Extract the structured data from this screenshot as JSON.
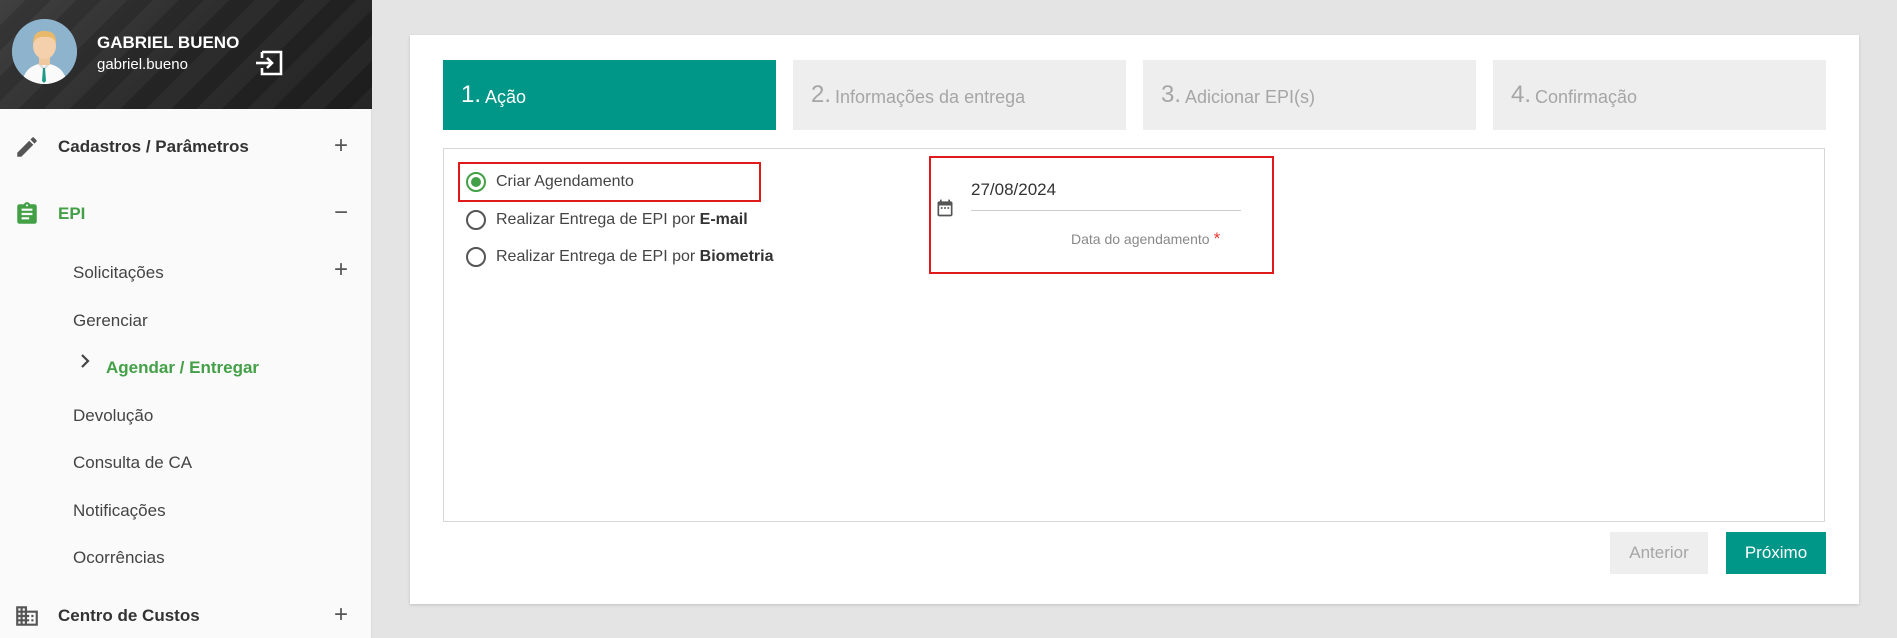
{
  "user": {
    "name": "GABRIEL BUENO",
    "login": "gabriel.bueno"
  },
  "sidebar": {
    "menus": [
      {
        "label": "Cadastros / Parâmetros",
        "toggle": "+"
      },
      {
        "label": "EPI",
        "toggle": "−"
      },
      {
        "label": "Centro de Custos",
        "toggle": "+"
      }
    ],
    "sub_items": [
      {
        "label": "Solicitações",
        "toggle": "+"
      },
      {
        "label": "Gerenciar"
      },
      {
        "label": "Agendar / Entregar"
      },
      {
        "label": "Devolução"
      },
      {
        "label": "Consulta de CA"
      },
      {
        "label": "Notificações"
      },
      {
        "label": "Ocorrências"
      }
    ]
  },
  "wizard": {
    "steps": [
      {
        "num": "1.",
        "label": "Ação"
      },
      {
        "num": "2.",
        "label": "Informações da entrega"
      },
      {
        "num": "3.",
        "label": "Adicionar EPI(s)"
      },
      {
        "num": "4.",
        "label": "Confirmação"
      }
    ],
    "options": {
      "criar": "Criar Agendamento",
      "email_prefix": "Realizar Entrega de EPI por ",
      "email_bold": "E-mail",
      "bio_prefix": "Realizar Entrega de EPI por ",
      "bio_bold": "Biometria"
    },
    "date_value": "27/08/2024",
    "date_label": "Data do agendamento",
    "required_mark": "*",
    "prev_label": "Anterior",
    "next_label": "Próximo"
  },
  "colors": {
    "accent": "#009688",
    "active_green": "#43a047",
    "highlight_red": "#e01a1a"
  }
}
